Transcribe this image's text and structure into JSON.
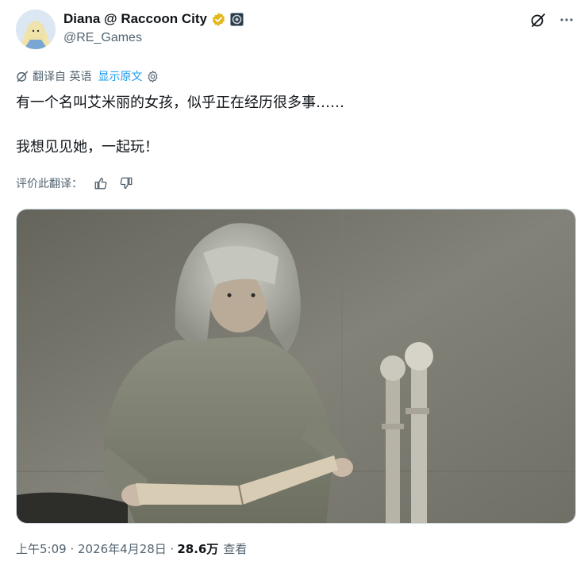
{
  "author": {
    "display_name": "Diana @ Raccoon City",
    "handle": "@RE_Games",
    "verified_color": "#e2b719"
  },
  "translation": {
    "label": "翻译自 英语",
    "show_original": "显示原文"
  },
  "tweet": {
    "line1": "有一个名叫艾米丽的女孩，似乎正在经历很多事……",
    "line2": "我想见见她，一起玩！"
  },
  "rate_translation": "评价此翻译：",
  "meta": {
    "time_date": "上午5:09 · 2026年4月28日 · ",
    "views": "28.6万",
    "views_label": "查看"
  },
  "colors": {
    "accent": "#1d9bf0",
    "text": "#0f1419",
    "secondary": "#536471"
  },
  "icons": [
    "grok-icon",
    "more-icon",
    "translate-icon",
    "settings-icon",
    "like-translation-icon",
    "dislike-translation-icon",
    "verified-badge-icon",
    "affiliate-badge-icon"
  ]
}
